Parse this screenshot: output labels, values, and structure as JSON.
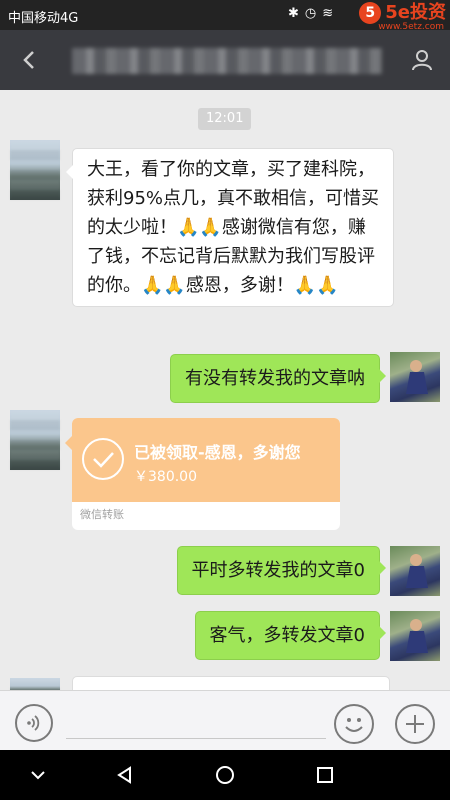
{
  "status_bar": {
    "carrier": "中国移动4G",
    "icons": [
      "bluetooth-icon",
      "alarm-icon",
      "wifi-icon"
    ],
    "watermark": {
      "badge": "5",
      "text": "5e投资",
      "url": "www.5etz.com",
      "color": "#e8441f"
    }
  },
  "nav_bar": {
    "back_icon": "back-arrow-icon",
    "title_pixelated": true,
    "profile_icon": "profile-icon"
  },
  "chat": {
    "timestamp": "12:01",
    "messages": [
      {
        "side": "left",
        "type": "text",
        "text": "大王，看了你的文章，买了建科院，获利95%点几，真不敢相信，可惜买的太少啦！🙏🙏感谢微信有您，赚了钱，不忘记背后默默为我们写股评的你。🙏🙏感恩，多谢！🙏🙏"
      },
      {
        "side": "right",
        "type": "text",
        "text": "有没有转发我的文章呐"
      },
      {
        "side": "left",
        "type": "transfer",
        "title": "已被领取-感恩，多谢您",
        "amount": "￥380.00",
        "footer": "微信转账",
        "color": "#fbc68c"
      },
      {
        "side": "right",
        "type": "text",
        "text": "平时多转发我的文章0"
      },
      {
        "side": "right",
        "type": "text",
        "text": "客气，多转发文章0"
      }
    ]
  },
  "input_bar": {
    "voice_icon": "voice-icon",
    "input_value": "",
    "emoji_icon": "emoji-icon",
    "plus_icon": "plus-icon"
  },
  "system_nav": [
    "chevron-down-icon",
    "back-triangle-icon",
    "home-circle-icon",
    "recents-square-icon"
  ],
  "colors": {
    "nav": "#393a3f",
    "chat_bg": "#ebebeb",
    "green_bubble": "#9fe658"
  }
}
